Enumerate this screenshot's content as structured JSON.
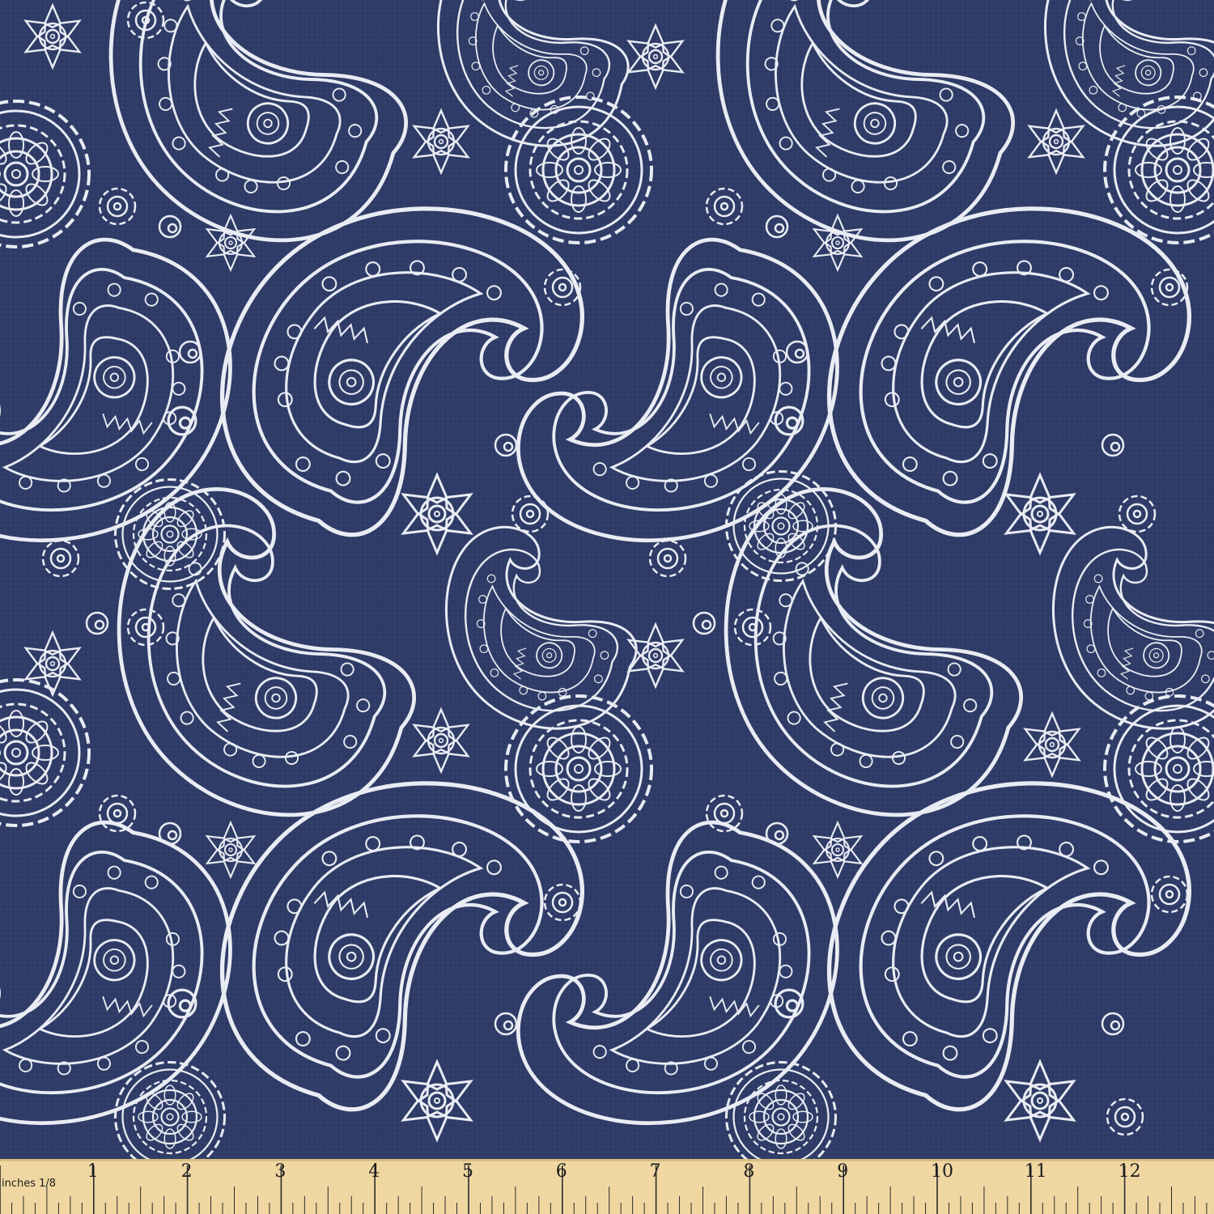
{
  "fabric": {
    "background_color": "#2f3c67",
    "line_color": "#e9ecf3",
    "motifs": [
      "paisley-icon",
      "mandala-icon",
      "flower-icon",
      "circle-dot-icon"
    ]
  },
  "ruler": {
    "unit_label": "inches 1/8",
    "numbers": [
      "1",
      "2",
      "3",
      "4",
      "5",
      "6",
      "7",
      "8",
      "9",
      "10",
      "11",
      "12",
      "1"
    ],
    "color": "#f0d7a2"
  }
}
